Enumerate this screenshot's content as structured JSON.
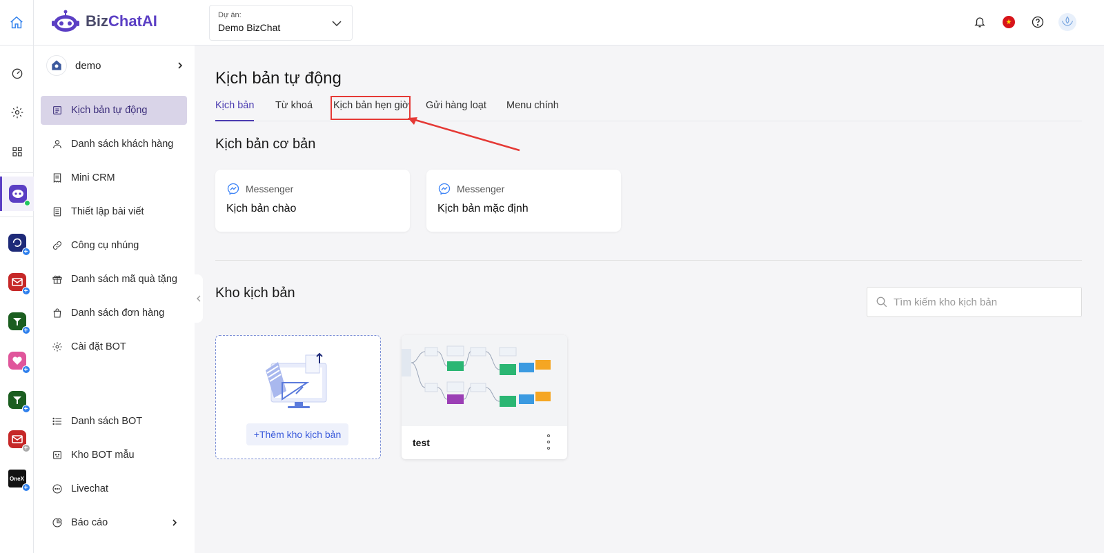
{
  "header": {
    "logo_part1": "Biz",
    "logo_part2": "ChatAI",
    "project_label": "Dự án:",
    "project_value": "Demo BizChat",
    "flag_symbol": "★"
  },
  "rail": {
    "onex_label": "OneX",
    "badge_symbol": "+"
  },
  "sidebar": {
    "bot_name": "demo",
    "items": [
      {
        "label": "Kịch bản tự động"
      },
      {
        "label": "Danh sách khách hàng"
      },
      {
        "label": "Mini CRM"
      },
      {
        "label": "Thiết lập bài viết"
      },
      {
        "label": "Công cụ nhúng"
      },
      {
        "label": "Danh sách mã quà tặng"
      },
      {
        "label": "Danh sách đơn hàng"
      },
      {
        "label": "Cài đặt BOT"
      },
      {
        "label": "Danh sách BOT"
      },
      {
        "label": "Kho BOT mẫu"
      },
      {
        "label": "Livechat"
      },
      {
        "label": "Báo cáo"
      }
    ]
  },
  "main": {
    "title": "Kịch bản tự động",
    "tabs": [
      {
        "label": "Kịch bản"
      },
      {
        "label": "Từ khoá"
      },
      {
        "label": "Kịch bản hẹn giờ"
      },
      {
        "label": "Gửi hàng loạt"
      },
      {
        "label": "Menu chính"
      }
    ],
    "basic_section_title": "Kịch bản cơ bản",
    "basic_cards": [
      {
        "channel": "Messenger",
        "name": "Kịch bản chào"
      },
      {
        "channel": "Messenger",
        "name": "Kịch bản mặc định"
      }
    ],
    "library_title": "Kho kịch bản",
    "search_placeholder": "Tìm kiếm kho kịch bản",
    "add_label": "+Thêm kho kịch bản",
    "templates": [
      {
        "name": "test"
      }
    ]
  },
  "colors": {
    "accent": "#5b3fc4",
    "active_tab": "#4a3bb0",
    "highlight": "#e53935"
  }
}
